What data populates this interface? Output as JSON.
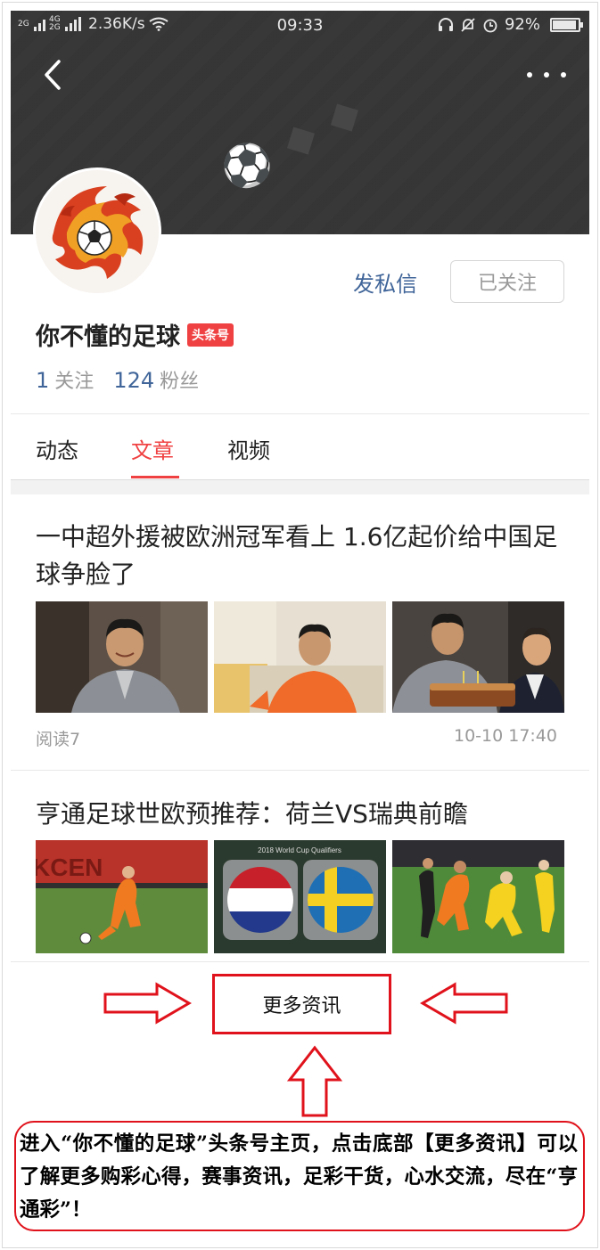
{
  "status_bar": {
    "network_left": "2G",
    "network_right": "4G 2G",
    "speed": "2.36K/s",
    "time": "09:33",
    "battery": "92%",
    "battery_level": 0.92
  },
  "profile": {
    "name": "你不懂的足球",
    "badge": "头条号",
    "message_label": "发私信",
    "follow_label": "已关注",
    "following_count": "1",
    "following_label": "关注",
    "fans_count": "124",
    "fans_label": "粉丝"
  },
  "tabs": [
    {
      "label": "动态",
      "active": false
    },
    {
      "label": "文章",
      "active": true
    },
    {
      "label": "视频",
      "active": false
    }
  ],
  "articles": [
    {
      "title": "一中超外援被欧洲冠军看上 1.6亿起价给中国足球争脸了",
      "reads": "阅读7",
      "date": "10-10 17:40"
    },
    {
      "title": "亨通足球世欧预推荐：荷兰VS瑞典前瞻"
    }
  ],
  "thumb_texts": {
    "wc_banner": "2018 World Cup Qualifiers",
    "ad_board": "KCEN"
  },
  "more_news_label": "更多资讯",
  "note": "进入“你不懂的足球”头条号主页，点击底部【更多资讯】可以了解更多购彩心得，赛事资讯，足彩干货，心水交流，尽在“亨通彩”！",
  "colors": {
    "accent_red": "#f04142",
    "link_blue": "#406599",
    "annotation_red": "#e0121b"
  }
}
